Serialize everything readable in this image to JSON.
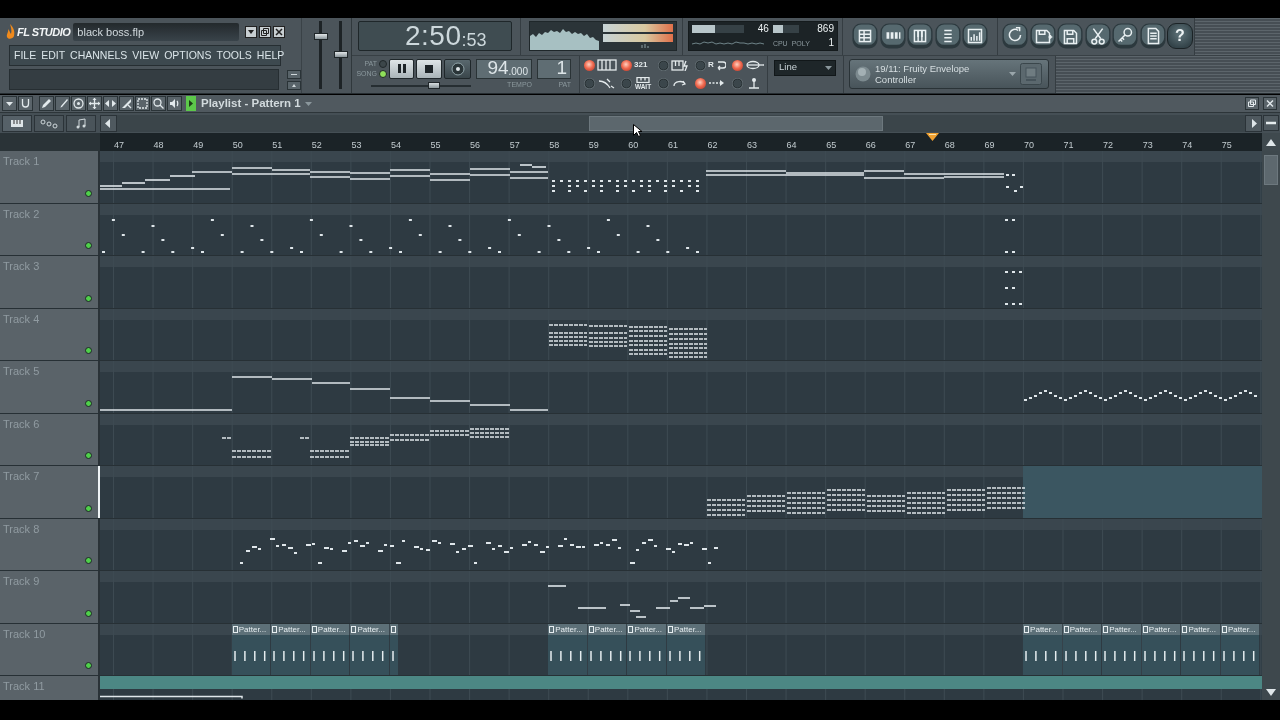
{
  "titlebar": {
    "logo": "FL STUDIO",
    "project": "black boss.flp"
  },
  "menu": [
    "FILE",
    "EDIT",
    "CHANNELS",
    "VIEW",
    "OPTIONS",
    "TOOLS",
    "HELP"
  ],
  "master_sliders": [
    {
      "level": 0.8
    },
    {
      "level": 0.5
    }
  ],
  "time_display": {
    "time": "2:50",
    "ticks": ":53"
  },
  "performance": {
    "meters": [
      {
        "reading": "46",
        "level": 0.45
      },
      {
        "reading": "869",
        "level": 0.4
      }
    ],
    "labels": [
      "CPU",
      "POLY"
    ],
    "polyphony": "1"
  },
  "help_button": {
    "label": "?"
  },
  "transport": {
    "modes": [
      {
        "label": "PAT",
        "selected": false
      },
      {
        "label": "SONG",
        "selected": true
      }
    ],
    "tempo_slider": {
      "level": 0.65
    },
    "tempo": {
      "value": "94",
      "decimals": ".000",
      "label": "TEMPO"
    },
    "pattern": {
      "value": "1",
      "label": "PAT"
    }
  },
  "record_toggles": [
    {
      "on": true
    },
    {
      "on": true,
      "label": "321"
    },
    {
      "on": false
    },
    {
      "on": false,
      "label": "R"
    },
    {
      "on": true
    },
    {
      "on": false
    },
    {
      "on": false,
      "label": "WAIT"
    },
    {
      "on": false
    },
    {
      "on": true
    },
    {
      "on": false
    }
  ],
  "snap": {
    "value": "Line"
  },
  "plugin_picker": {
    "text": "19/11: Fruity Envelope Controller"
  },
  "playlist": {
    "title": "Playlist - Pattern 1",
    "ruler": [
      "47",
      "48",
      "49",
      "50",
      "51",
      "52",
      "53",
      "54",
      "55",
      "56",
      "57",
      "58",
      "59",
      "60",
      "61",
      "62",
      "63",
      "64",
      "65",
      "66",
      "67",
      "68",
      "69",
      "70",
      "71",
      "72",
      "73",
      "74",
      "75"
    ],
    "tracks": [
      {
        "name": "Track 1",
        "enabled": true,
        "selected": false
      },
      {
        "name": "Track 2",
        "enabled": true,
        "selected": false
      },
      {
        "name": "Track 3",
        "enabled": true,
        "selected": false
      },
      {
        "name": "Track 4",
        "enabled": true,
        "selected": false
      },
      {
        "name": "Track 5",
        "enabled": true,
        "selected": false
      },
      {
        "name": "Track 6",
        "enabled": true,
        "selected": false
      },
      {
        "name": "Track 7",
        "enabled": true,
        "selected": true
      },
      {
        "name": "Track 8",
        "enabled": true,
        "selected": false
      },
      {
        "name": "Track 9",
        "enabled": true,
        "selected": false
      },
      {
        "name": "Track 10",
        "enabled": true,
        "selected": false,
        "clips": [
          {
            "kind": "labelled",
            "label": "Patter..."
          },
          {
            "kind": "labelled",
            "label": "Patter..."
          },
          {
            "kind": "labelled",
            "label": "Patter..."
          },
          {
            "kind": "labelled",
            "label": "Patter..."
          },
          {
            "kind": "stub"
          },
          {
            "kind": "labelled",
            "label": "Patter..."
          },
          {
            "kind": "labelled",
            "label": "Patter..."
          },
          {
            "kind": "labelled",
            "label": "Patter..."
          },
          {
            "kind": "labelled",
            "label": "Patter..."
          },
          {
            "kind": "labelled",
            "label": "Patter..."
          },
          {
            "kind": "labelled",
            "label": "Patter..."
          },
          {
            "kind": "labelled",
            "label": "Patter..."
          },
          {
            "kind": "labelled",
            "label": "Patter..."
          },
          {
            "kind": "labelled",
            "label": "Patter..."
          },
          {
            "kind": "labelled",
            "label": "Patter..."
          }
        ]
      },
      {
        "name": "Track 11",
        "selected": false
      }
    ]
  }
}
